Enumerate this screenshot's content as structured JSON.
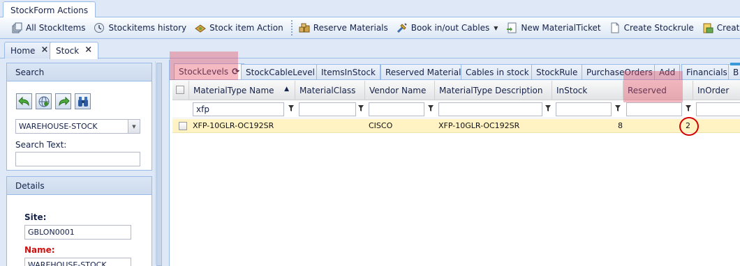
{
  "ribbon": {
    "tab_label": "StockForm Actions",
    "buttons": [
      {
        "label": "All StockItems",
        "icon": "stack-icon"
      },
      {
        "label": "Stockitems history",
        "icon": "history-icon"
      },
      {
        "label": "Stock item Action",
        "icon": "action-icon"
      },
      {
        "label": "Reserve Materials",
        "icon": "reserve-icon"
      },
      {
        "label": "Book in/out Cables",
        "icon": "cable-icon"
      },
      {
        "label": "New MaterialTicket",
        "icon": "ticket-icon"
      },
      {
        "label": "Create Stockrule",
        "icon": "document-icon"
      },
      {
        "label": "Create New Pu",
        "icon": "purchase-icon"
      }
    ]
  },
  "page_tabs": [
    {
      "label": "Home"
    },
    {
      "label": "Stock"
    }
  ],
  "search_panel": {
    "title": "Search",
    "warehouse": "WAREHOUSE-STOCK",
    "search_text_label": "Search Text:",
    "search_text_value": ""
  },
  "details_panel": {
    "title": "Details",
    "site_label": "Site:",
    "site_value": "GBLON0001",
    "name_label": "Name:",
    "name_value": "WAREHOUSE-STOCK"
  },
  "inner_tabs": [
    {
      "label": "StockLevels"
    },
    {
      "label": "StockCableLevel"
    },
    {
      "label": "ItemsInStock"
    },
    {
      "label": "Reserved Material"
    },
    {
      "label": "Cables in stock"
    },
    {
      "label": "StockRule"
    },
    {
      "label": "PurchaseOrders"
    },
    {
      "label": "Add"
    },
    {
      "label": "Financials"
    },
    {
      "label": "B"
    }
  ],
  "grid": {
    "columns": [
      "MaterialType Name",
      "MaterialClass",
      "Vendor Name",
      "MaterialType Description",
      "InStock",
      "Reserved",
      "InOrder"
    ],
    "filters": [
      "xfp",
      "",
      "",
      "",
      "",
      "",
      ""
    ],
    "rows": [
      {
        "name": "XFP-10GLR-OC192SR",
        "class": "",
        "vendor": "CISCO",
        "description": "XFP-10GLR-OC192SR",
        "instock": "8",
        "reserved": "2",
        "inorder": ""
      }
    ]
  },
  "colors": {
    "accent": "#99bbe8",
    "highlight": "#e65064",
    "selected_row": "#fff3c4",
    "required_label": "#cc1111"
  }
}
